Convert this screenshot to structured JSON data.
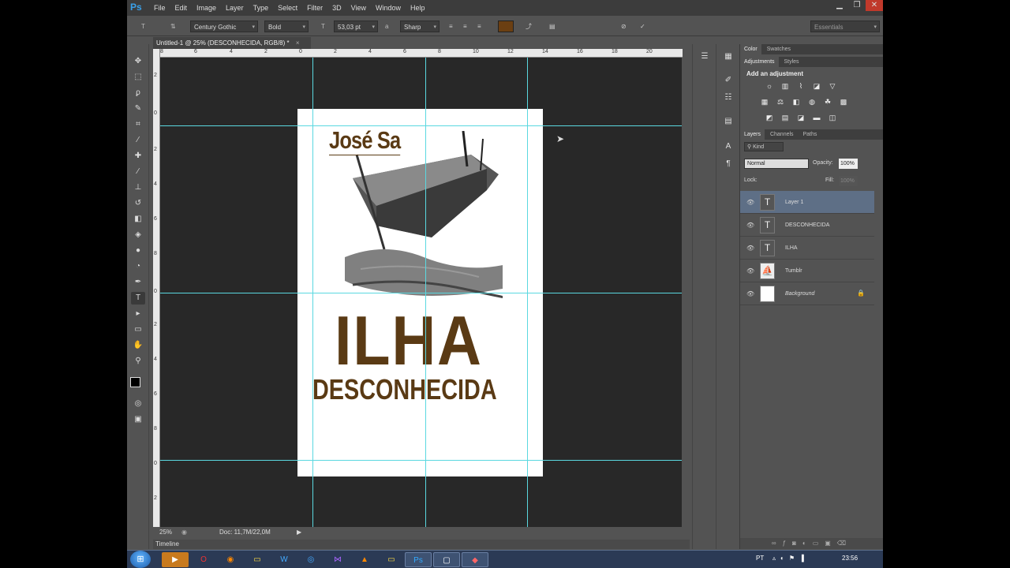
{
  "menubar": {
    "logo": "Ps",
    "items": [
      "File",
      "Edit",
      "Image",
      "Layer",
      "Type",
      "Select",
      "Filter",
      "3D",
      "View",
      "Window",
      "Help"
    ],
    "window_controls": [
      "▁",
      "❐",
      "✕"
    ]
  },
  "options_bar": {
    "font_family": "Century Gothic",
    "font_style": "Bold",
    "font_size": "53,03 pt",
    "aa_label": "a",
    "anti_alias": "Sharp",
    "text_color": "#6b3f12",
    "workspace": "Essentials"
  },
  "document": {
    "tab_title": "Untitled-1 @ 25% (DESCONHECIDA, RGB/8) *",
    "close": "×"
  },
  "rulers": {
    "h_labels": [
      "8",
      "6",
      "4",
      "2",
      "0",
      "2",
      "4",
      "6",
      "8",
      "10",
      "12",
      "14",
      "16",
      "18",
      "20"
    ],
    "v_labels": [
      "2",
      "0",
      "2",
      "4",
      "6",
      "8",
      "0",
      "2",
      "4",
      "6",
      "8",
      "0",
      "2",
      "4",
      "6",
      "8",
      "0",
      "2",
      "4"
    ]
  },
  "artwork": {
    "author": "José Sa",
    "title": "ILHA",
    "subtitle": "DESCONHECIDA"
  },
  "status": {
    "zoom": "25%",
    "doc_size": "Doc: 11,7M/22,0M"
  },
  "timeline": {
    "label": "Timeline"
  },
  "panels": {
    "top_tabs": [
      "Color",
      "Swatches"
    ],
    "adj_tabs": [
      "Adjustments",
      "Styles"
    ],
    "adj_title": "Add an adjustment",
    "layer_tabs": [
      "Layers",
      "Channels",
      "Paths"
    ],
    "kind_filter": "Kind",
    "blend_mode": "Normal",
    "opacity_label": "Opacity:",
    "opacity": "100%",
    "lock_label": "Lock:",
    "fill_label": "Fill:",
    "fill": "100%",
    "layers": [
      {
        "name": "Layer 1",
        "type": "text",
        "selected": true
      },
      {
        "name": "DESCONHECIDA",
        "type": "text",
        "selected": false
      },
      {
        "name": "ILHA",
        "type": "text",
        "selected": false
      },
      {
        "name": "Tumblr",
        "type": "image",
        "selected": false
      },
      {
        "name": "Background",
        "type": "background",
        "selected": false
      }
    ]
  },
  "taskbar": {
    "lang": "PT",
    "time": "23:56"
  }
}
